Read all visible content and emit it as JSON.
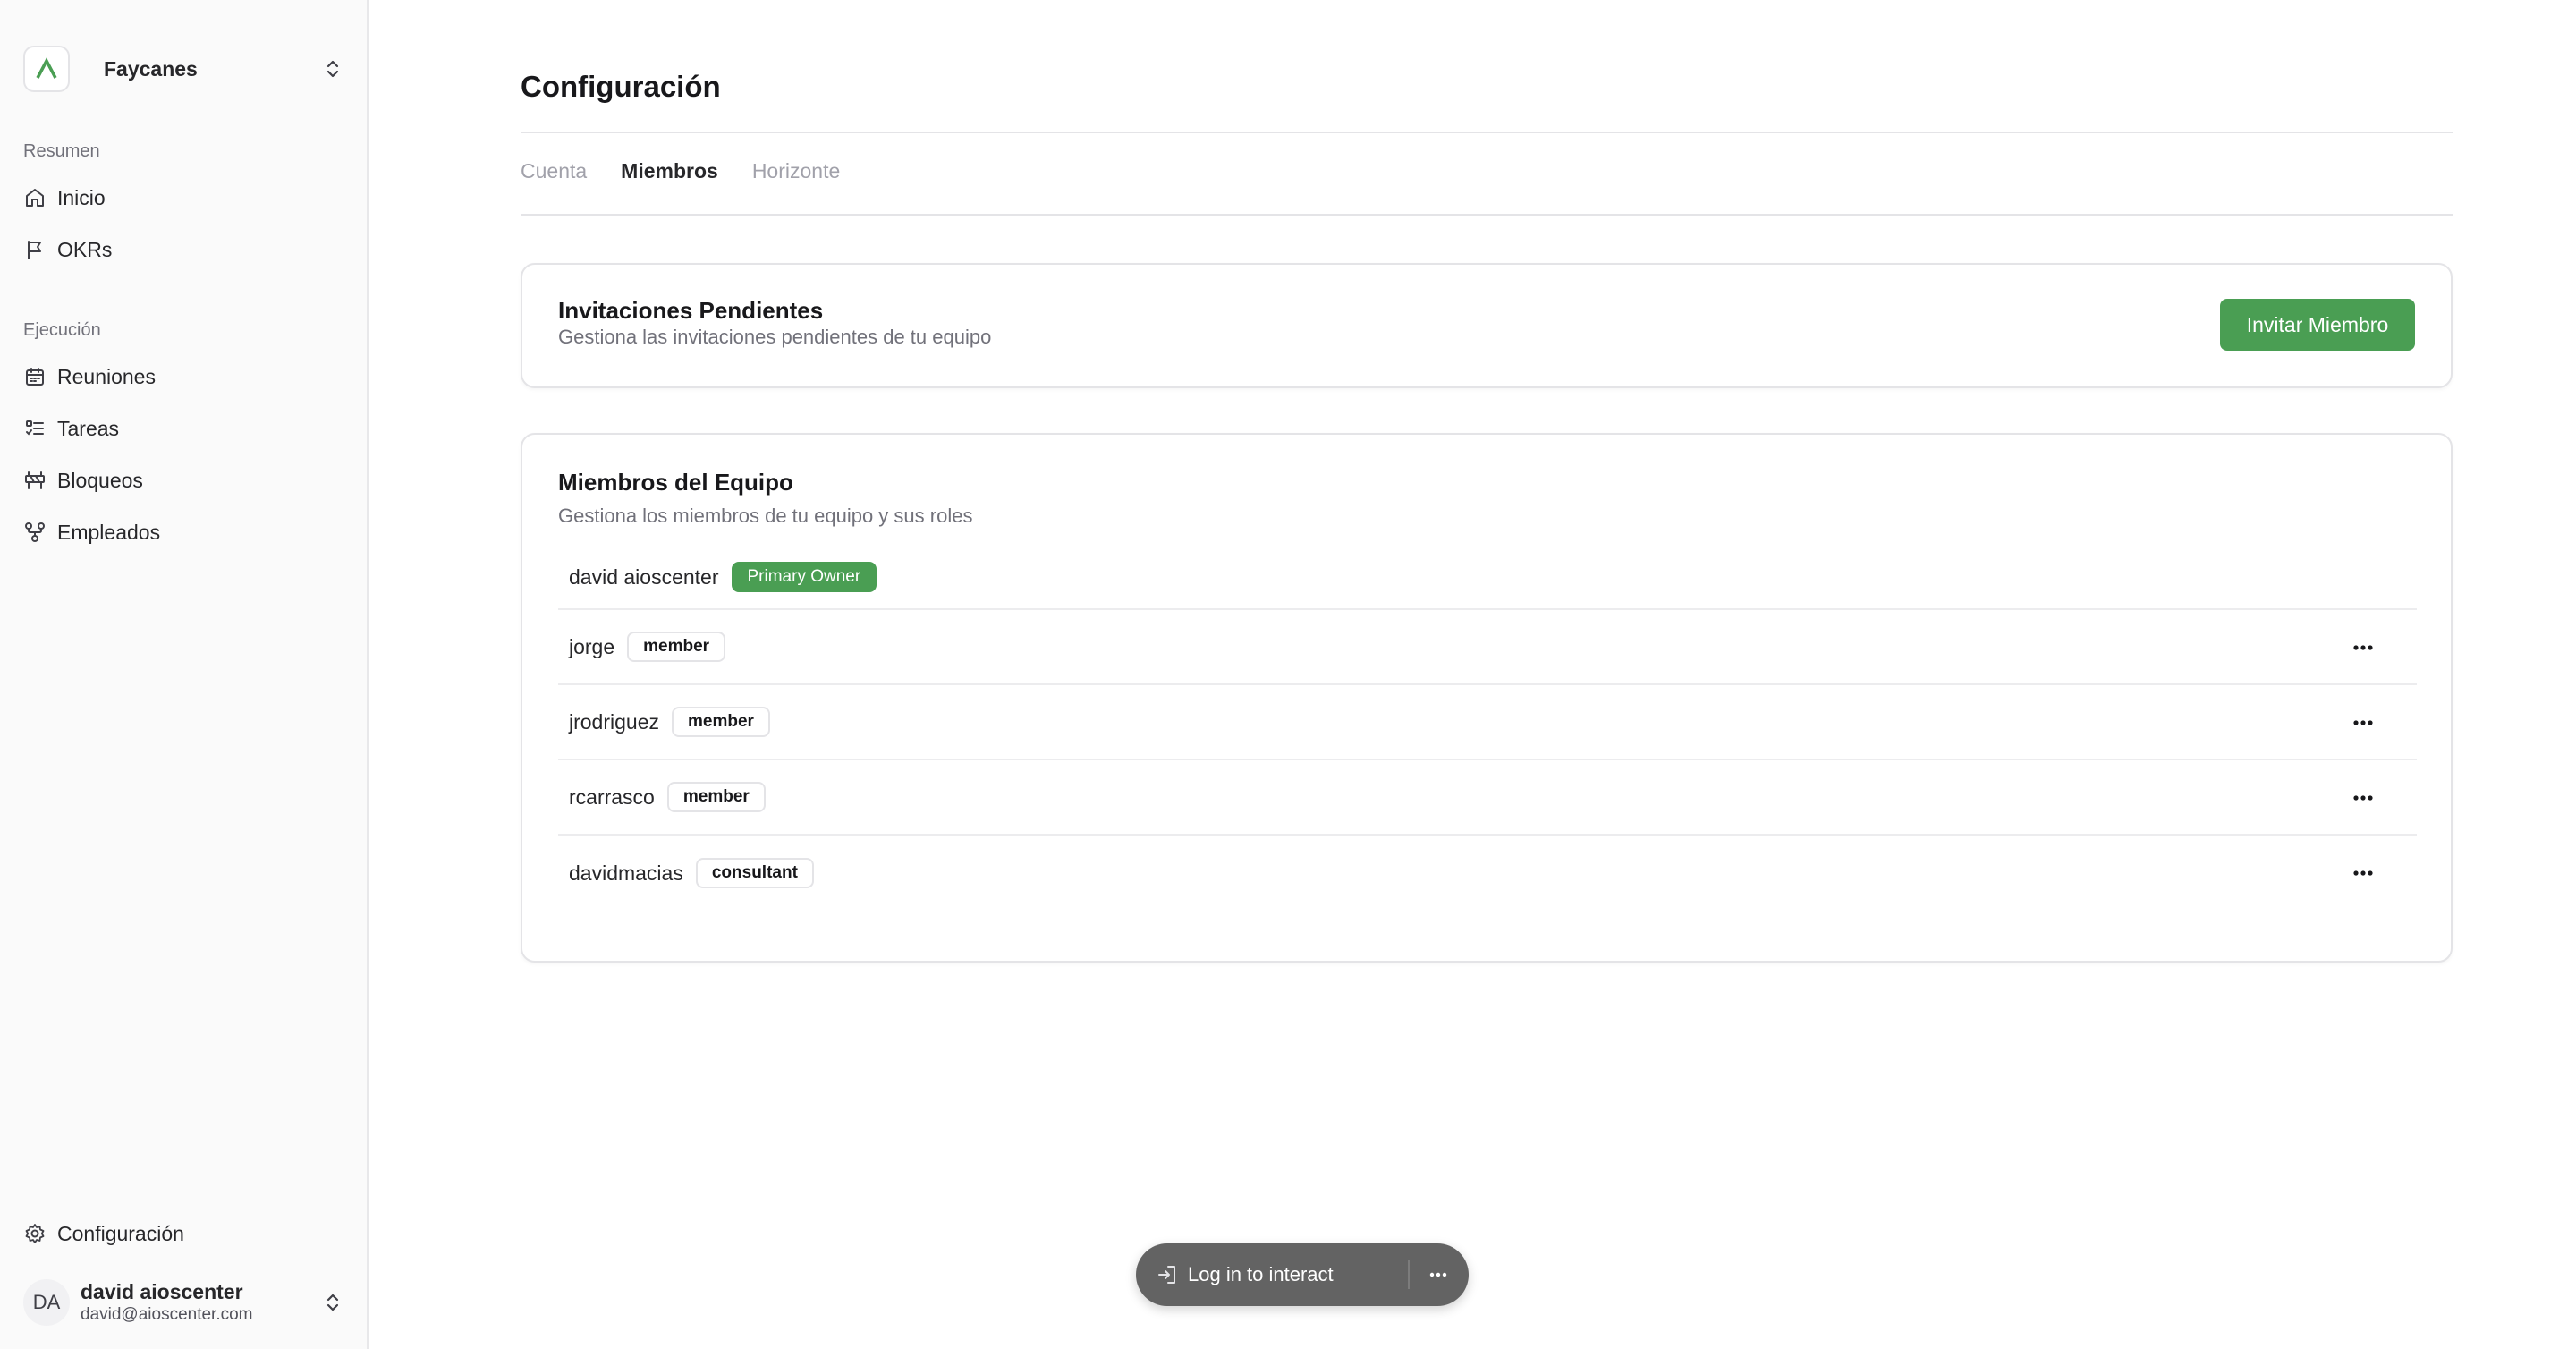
{
  "sidebar": {
    "org_name": "Faycanes",
    "sections": [
      {
        "label": "Resumen",
        "items": [
          {
            "label": "Inicio",
            "icon": "home-icon"
          },
          {
            "label": "OKRs",
            "icon": "flag-icon"
          }
        ]
      },
      {
        "label": "Ejecución",
        "items": [
          {
            "label": "Reuniones",
            "icon": "calendar-icon"
          },
          {
            "label": "Tareas",
            "icon": "list-check-icon"
          },
          {
            "label": "Bloqueos",
            "icon": "roadblock-icon"
          },
          {
            "label": "Empleados",
            "icon": "org-chart-icon"
          }
        ]
      }
    ],
    "settings_label": "Configuración",
    "user": {
      "initials": "DA",
      "name": "david aioscenter",
      "email": "david@aioscenter.com"
    }
  },
  "page": {
    "title": "Configuración",
    "tabs": [
      {
        "label": "Cuenta",
        "active": false
      },
      {
        "label": "Miembros",
        "active": true
      },
      {
        "label": "Horizonte",
        "active": false
      }
    ]
  },
  "invitations": {
    "title": "Invitaciones Pendientes",
    "description": "Gestiona las invitaciones pendientes de tu equipo",
    "invite_button": "Invitar Miembro"
  },
  "members": {
    "title": "Miembros del Equipo",
    "description": "Gestiona los miembros de tu equipo y sus roles",
    "rows": [
      {
        "name": "david aioscenter",
        "role": "Primary Owner"
      },
      {
        "name": "jorge",
        "role": "member"
      },
      {
        "name": "jrodriguez",
        "role": "member"
      },
      {
        "name": "rcarrasco",
        "role": "member"
      },
      {
        "name": "davidmacias",
        "role": "consultant"
      }
    ]
  },
  "overlay": {
    "login_text": "Log in to interact"
  },
  "colors": {
    "accent": "#4a9e53",
    "pill_bg": "#636363"
  }
}
